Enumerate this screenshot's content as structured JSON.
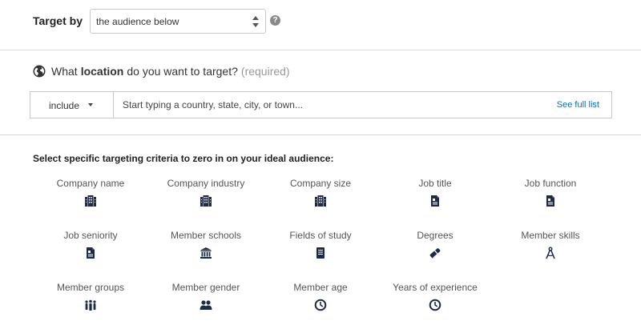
{
  "target": {
    "label": "Target by",
    "select_value": "the audience below",
    "help_icon": "?"
  },
  "location": {
    "heading_pre": "What",
    "heading_bold": "location",
    "heading_post": "do you want to target?",
    "required": "(required)",
    "include_label": "include",
    "input_placeholder": "Start typing a country, state, city, or town...",
    "see_full_list": "See full list",
    "icon": "globe-icon"
  },
  "criteria": {
    "heading": "Select specific targeting criteria to zero in on your ideal audience:",
    "items": [
      {
        "label": "Company name",
        "icon": "building-icon"
      },
      {
        "label": "Company industry",
        "icon": "building-icon"
      },
      {
        "label": "Company size",
        "icon": "building-icon"
      },
      {
        "label": "Job title",
        "icon": "id-card-icon"
      },
      {
        "label": "Job function",
        "icon": "id-card-icon"
      },
      {
        "label": "Job seniority",
        "icon": "id-card-icon"
      },
      {
        "label": "Member schools",
        "icon": "school-icon"
      },
      {
        "label": "Fields of study",
        "icon": "book-icon"
      },
      {
        "label": "Degrees",
        "icon": "diploma-icon"
      },
      {
        "label": "Member skills",
        "icon": "compass-icon"
      },
      {
        "label": "Member groups",
        "icon": "group-icon"
      },
      {
        "label": "Member gender",
        "icon": "gender-icon"
      },
      {
        "label": "Member age",
        "icon": "clock-icon"
      },
      {
        "label": "Years of experience",
        "icon": "clock-icon"
      }
    ]
  },
  "colors": {
    "link": "#0073b1",
    "icon": "#1f2a44",
    "muted": "#999999"
  }
}
